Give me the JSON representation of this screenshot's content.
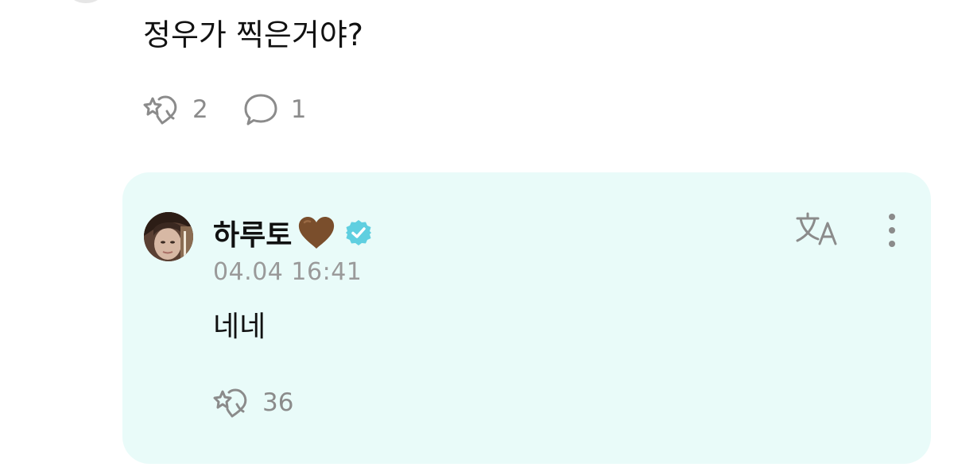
{
  "comment": {
    "text": "정우가 찍은거야?",
    "likes_count": "2",
    "replies_count": "1"
  },
  "reply": {
    "author_name": "하루토",
    "author_emoji": "brown-heart-icon",
    "verified": true,
    "timestamp": "04.04 16:41",
    "text": "네네",
    "likes_count": "36"
  },
  "colors": {
    "card_background": "#e9fbf9",
    "verified_badge": "#5fcfe0",
    "icon_gray": "#8b8b8b",
    "heart_brown": "#7a4e2c"
  },
  "icons": {
    "like": "sparkle-heart-icon",
    "reply": "speech-bubble-icon",
    "translate": "translate-icon",
    "more": "more-vertical-icon"
  }
}
